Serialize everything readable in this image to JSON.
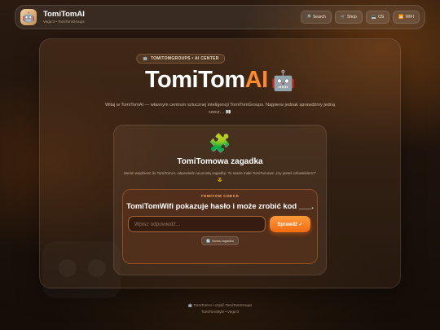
{
  "header": {
    "logo_icon": "robot-icon",
    "logo_glyph": "🤖",
    "title": "TomiTomAI",
    "subtitle": "Vega 0 • TomiTomGroups",
    "nav": [
      {
        "icon": "🔎",
        "label": "Search"
      },
      {
        "icon": "🛒",
        "label": "Shop"
      },
      {
        "icon": "💻",
        "label": "OS"
      },
      {
        "icon": "📶",
        "label": "WIFI"
      }
    ]
  },
  "hero": {
    "pill_icon": "🤖",
    "pill": "TOMITOMGROUPS • AI CENTER",
    "title_main": "TomiTom",
    "title_accent": "AI",
    "title_emoji": "🤖",
    "description": "Witaj w TomiTomAI — własnym centrum sztucznej inteligencji TomiTomGroups. Najpierw jednak sprawdźmy jedną rzecz… 👀"
  },
  "puzzle": {
    "icon": "🧩",
    "title": "TomiTomowa zagadka",
    "description": "Zanim wejdziesz do TomiTomAI, odpowiedz na prostą zagadkę. To nasze małe TomiTomowe „czy jesteś człowiekiem?” 😎",
    "check_label": "TOMITOM CHECK",
    "question": "TomiTomWifi pokazuje hasło i może zrobić kod ___.",
    "answer_placeholder": "Wpisz odpowiedź...",
    "answer_value": "",
    "check_button": "Sprawdź ✓",
    "new_button_icon": "🔄",
    "new_button": "Nowa zagadka"
  },
  "footer": {
    "line1": "🤖 TomiTomAI • część TomiTomGroups",
    "line2": "TomiTomStyle • Vega 0"
  },
  "colors": {
    "accent": "#ff8a2b",
    "background": "#1c120b"
  }
}
